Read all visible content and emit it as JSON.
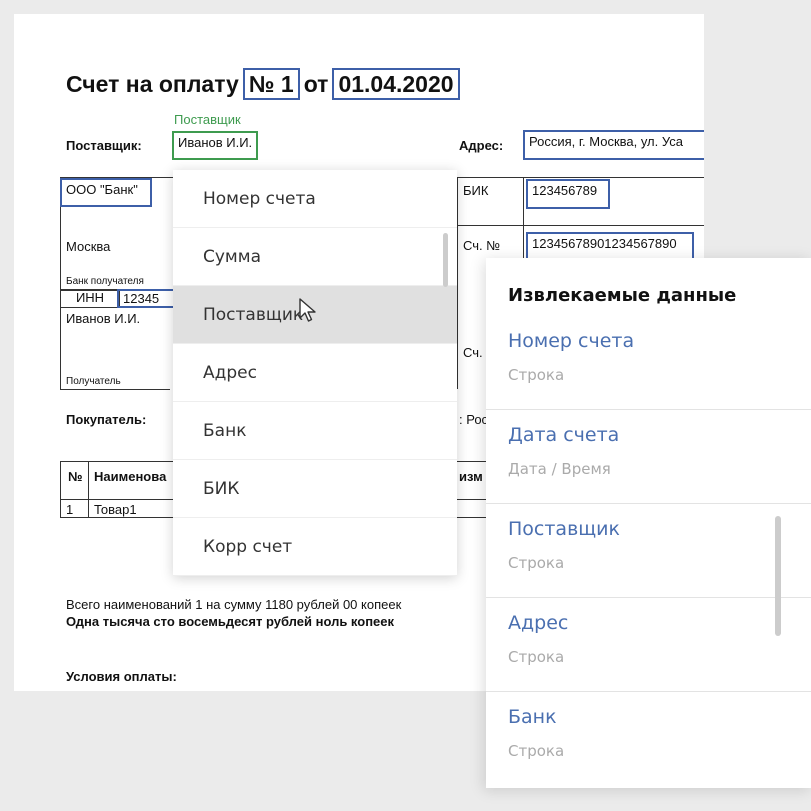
{
  "invoice": {
    "title_prefix": "Счет на оплату",
    "number": "№ 1",
    "from_word": "от",
    "date": "01.04.2020",
    "supplier_hint": "Поставщик",
    "supplier_label": "Поставщик:",
    "supplier_value": "Иванов И.И.",
    "address_label": "Адрес:",
    "address_value": "Россия, г. Москва, ул. Уса",
    "bank_name": "ООО \"Банк\"",
    "city": "Москва",
    "bank_recipient_label": "Банк получателя",
    "inn_label": "ИНН",
    "inn_value": "12345",
    "recipient_name": "Иванов И.И.",
    "recipient_label": "Получатель",
    "bik_label": "БИК",
    "bik_value": "123456789",
    "account_label": "Сч. №",
    "account_value": "12345678901234567890",
    "account_label2": "Сч.",
    "buyer_label": "Покупатель:",
    "buyer_fragment": ": Рос",
    "table": {
      "col_no": "№",
      "col_name": "Наименова",
      "col_unit": "изм",
      "row1_no": "1",
      "row1_name": "Товар1"
    },
    "total_text": "Всего наименований 1 на сумму 1180 рублей 00 копеек",
    "total_words": "Одна тысяча сто восемьдесят рублей ноль копеек",
    "payment_terms": "Условия оплаты:"
  },
  "dropdown": {
    "items": [
      {
        "label": "Номер счета"
      },
      {
        "label": "Сумма"
      },
      {
        "label": "Поставщик"
      },
      {
        "label": "Адрес"
      },
      {
        "label": "Банк"
      },
      {
        "label": "БИК"
      },
      {
        "label": "Корр счет"
      }
    ],
    "active_index": 2
  },
  "panel": {
    "title": "Извлекаемые данные",
    "fields": [
      {
        "name": "Номер счета",
        "type": "Строка"
      },
      {
        "name": "Дата счета",
        "type": "Дата / Время"
      },
      {
        "name": "Поставщик",
        "type": "Строка"
      },
      {
        "name": "Адрес",
        "type": "Строка"
      },
      {
        "name": "Банк",
        "type": "Строка"
      }
    ]
  },
  "colors": {
    "highlight_blue": "#3d5fa8",
    "highlight_green": "#3e9b4f",
    "field_name": "#4a6fb0"
  }
}
